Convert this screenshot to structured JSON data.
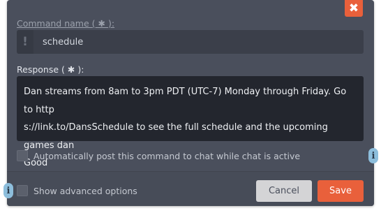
{
  "dialog": {
    "close_glyph": "✖",
    "command_name_label": "Command name (",
    "command_name_label_end": "):",
    "response_label": "Response (",
    "response_label_end": "):",
    "required_glyph": "✱",
    "command_prefix_glyph": "!",
    "command_name_value": "schedule",
    "response_lines": [
      "Dan streams from 8am to 3pm PDT (UTC-7) Monday through Friday. Go to http",
      "s://link.to/DansSchedule to see the full schedule and the upcoming games dan",
      "Good"
    ],
    "auto_post_label": "Automatically post this command to chat while chat is active",
    "advanced_label": "Show advanced options",
    "cancel_label": "Cancel",
    "save_label": "Save",
    "info_glyph": "i",
    "auto_post_checked": false,
    "advanced_checked": false
  },
  "colors": {
    "accent": "#e9603b",
    "modal_bg": "#4a4f5c",
    "response_bg": "#23262e",
    "info": "#8dbedc"
  }
}
